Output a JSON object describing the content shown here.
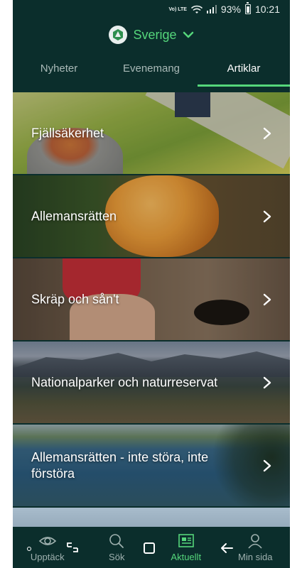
{
  "status_bar": {
    "volte": "Vo) LTE",
    "battery": "93%",
    "time": "10:21"
  },
  "region": {
    "name": "Sverige"
  },
  "tabs": [
    {
      "label": "Nyheter",
      "active": false
    },
    {
      "label": "Evenemang",
      "active": false
    },
    {
      "label": "Artiklar",
      "active": true
    }
  ],
  "articles": [
    {
      "title": "Fjällsäkerhet"
    },
    {
      "title": "Allemansrätten"
    },
    {
      "title": "Skräp och sån't"
    },
    {
      "title": "Nationalparker och naturreservat"
    },
    {
      "title": "Allemansrätten - inte störa, inte förstöra"
    },
    {
      "title": ""
    }
  ],
  "bottom_nav": [
    {
      "label": "Upptäck",
      "icon": "eye-icon",
      "active": false
    },
    {
      "label": "Sök",
      "icon": "search-icon",
      "active": false
    },
    {
      "label": "Aktuellt",
      "icon": "newspaper-icon",
      "active": true
    },
    {
      "label": "Min sida",
      "icon": "person-icon",
      "active": false
    }
  ],
  "colors": {
    "background": "#0b2e2c",
    "accent": "#55d67b",
    "text_inactive": "#a9b9b7"
  }
}
